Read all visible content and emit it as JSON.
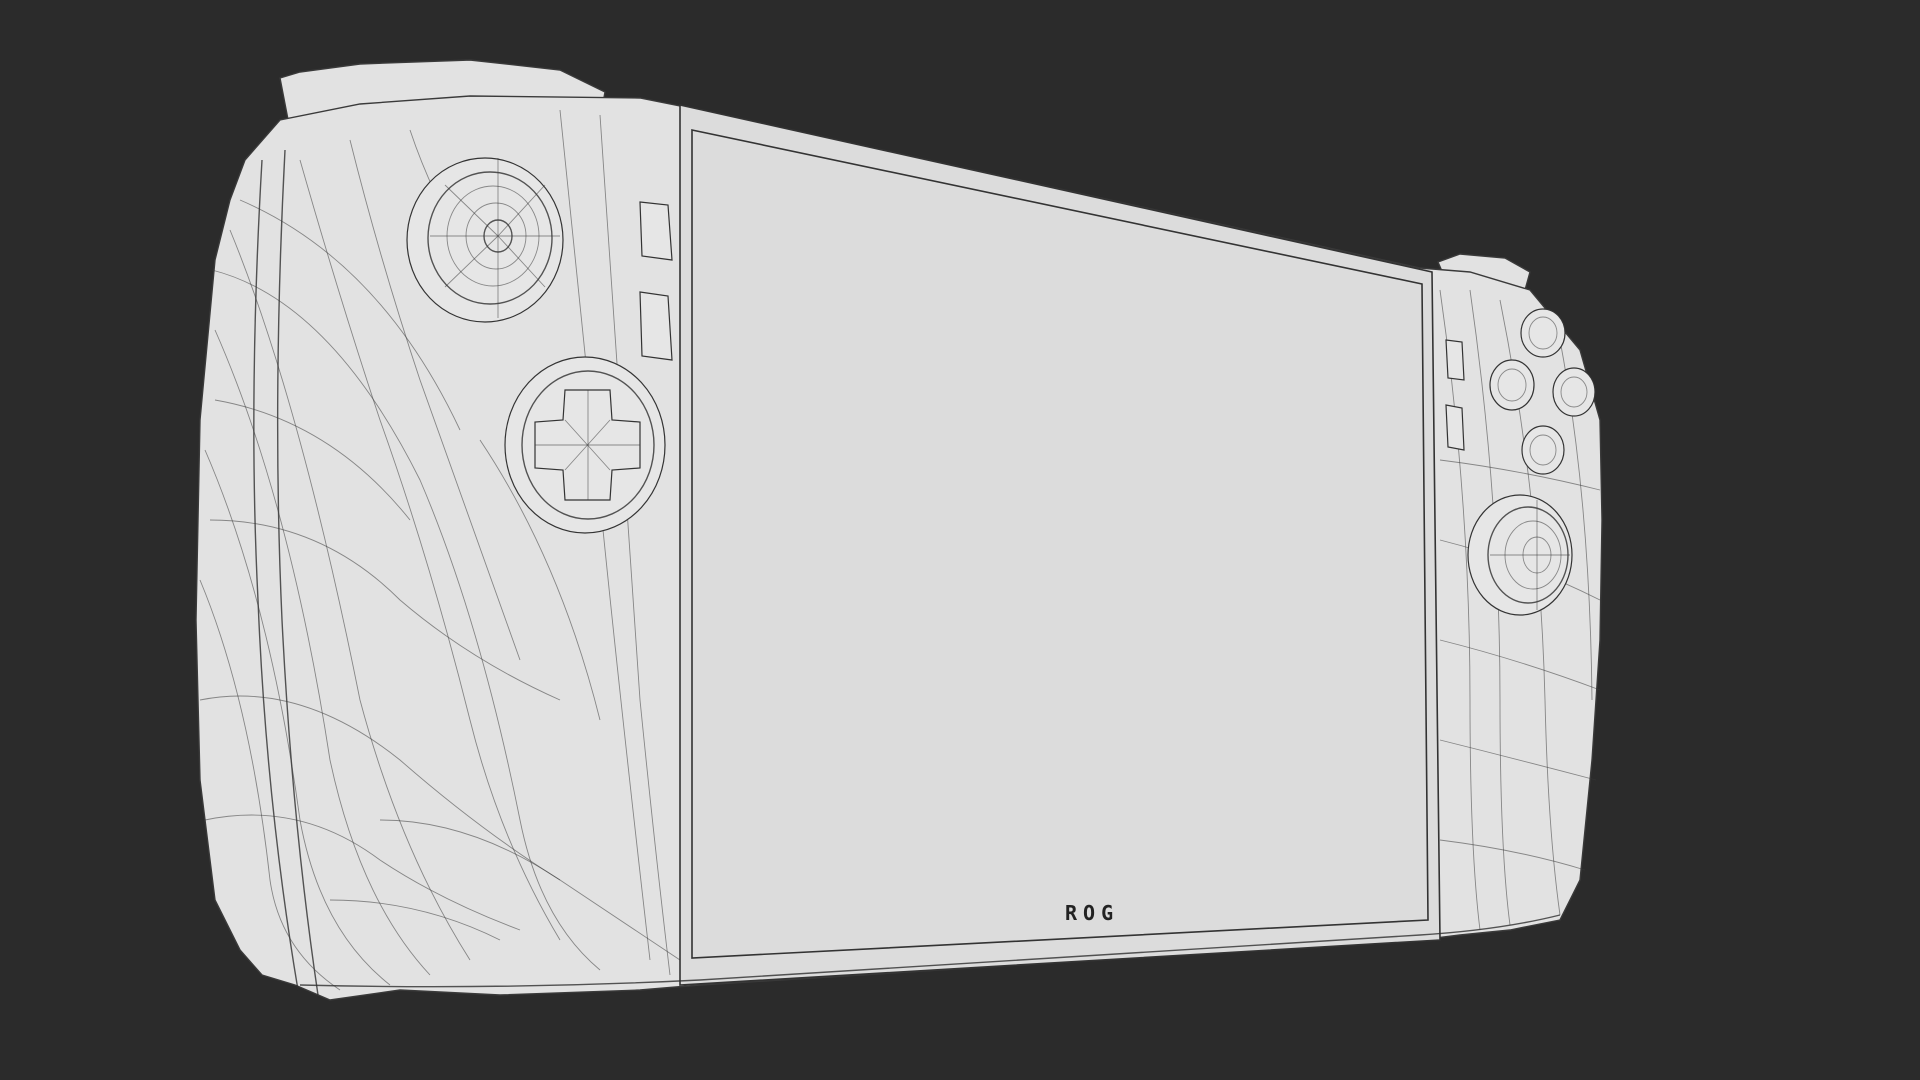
{
  "scene": {
    "background_color": "#2b2b2b",
    "device_color": "#e2e2e2",
    "wire_color": "#3a3a3a"
  },
  "device": {
    "logo_text": "ROG"
  }
}
